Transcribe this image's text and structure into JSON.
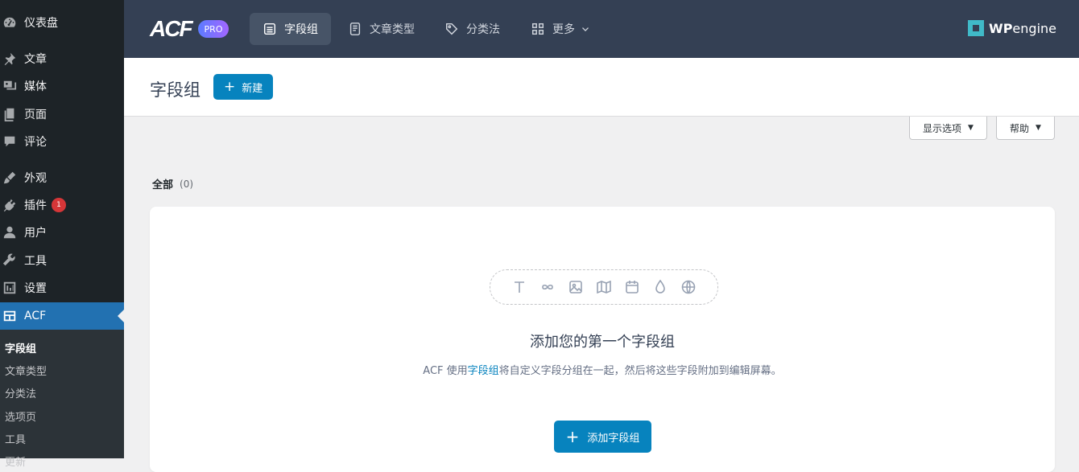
{
  "sidebar": {
    "items": [
      {
        "label": "仪表盘",
        "icon": "dashboard-icon"
      },
      {
        "label": "文章",
        "icon": "pin-icon"
      },
      {
        "label": "媒体",
        "icon": "media-icon"
      },
      {
        "label": "页面",
        "icon": "page-icon"
      },
      {
        "label": "评论",
        "icon": "comment-icon"
      },
      {
        "label": "外观",
        "icon": "brush-icon"
      },
      {
        "label": "插件",
        "icon": "plugin-icon",
        "badge": "1"
      },
      {
        "label": "用户",
        "icon": "user-icon"
      },
      {
        "label": "工具",
        "icon": "wrench-icon"
      },
      {
        "label": "设置",
        "icon": "settings-icon"
      },
      {
        "label": "ACF",
        "icon": "acf-icon"
      }
    ],
    "submenu": [
      "字段组",
      "文章类型",
      "分类法",
      "选项页",
      "工具",
      "更新"
    ]
  },
  "topbar": {
    "logo": "ACF",
    "pro": "PRO",
    "tabs": [
      "字段组",
      "文章类型",
      "分类法",
      "更多"
    ],
    "brand": "engine",
    "brand_bold": "WP"
  },
  "header": {
    "title": "字段组",
    "new_button": "新建"
  },
  "screen_options": {
    "display": "显示选项",
    "help": "帮助"
  },
  "filter": {
    "label": "全部",
    "count": "(0)"
  },
  "empty_state": {
    "title": "添加您的第一个字段组",
    "desc_prefix": "ACF 使用",
    "desc_link": "字段组",
    "desc_suffix": "将自定义字段分组在一起，然后将这些字段附加到编辑屏幕。",
    "button": "添加字段组"
  },
  "colors": {
    "sidebar_bg": "#1d2327",
    "topbar_bg": "#344054",
    "accent": "#0783be",
    "wp_blue": "#2271b1",
    "badge_red": "#d63638"
  }
}
